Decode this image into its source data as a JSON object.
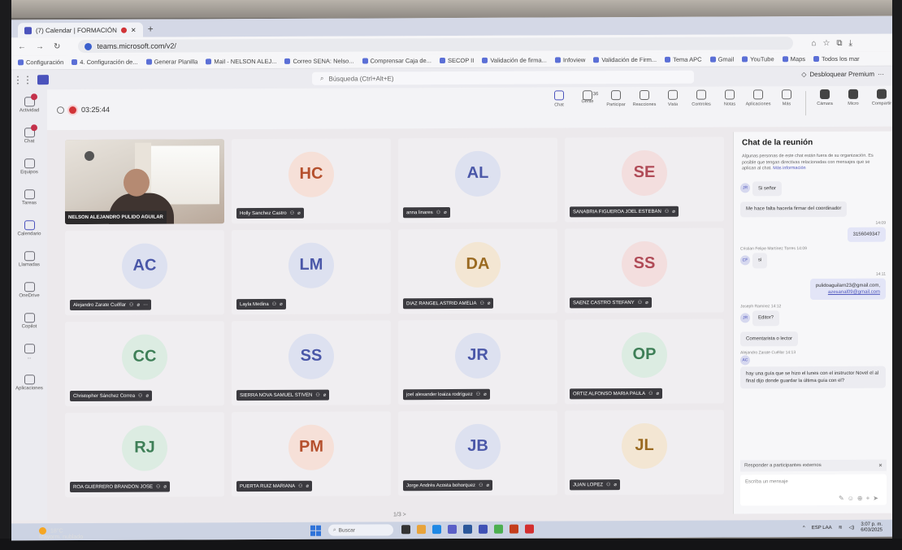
{
  "browser": {
    "tab_title": "(7) Calendar | FORMACIÓN",
    "url": "teams.microsoft.com/v2/",
    "bookmarks": [
      "Configuración",
      "4. Configuración de...",
      "Generar Planilla",
      "Mail - NELSON ALEJ...",
      "Correo SENA: Nelso...",
      "Comprensar Caja de...",
      "SECOP II",
      "Validación de firma...",
      "Infoview",
      "Validación de Firm...",
      "Tema APC",
      "Gmail",
      "YouTube",
      "Maps",
      "Todos los mar"
    ]
  },
  "teams": {
    "search_placeholder": "Búsqueda (Ctrl+Alt+E)",
    "premium_label": "Desbloquear Premium",
    "rail": [
      {
        "label": "Actividad",
        "badge": true
      },
      {
        "label": "Chat",
        "badge": true
      },
      {
        "label": "Equipos",
        "badge": false
      },
      {
        "label": "Tareas",
        "badge": false
      },
      {
        "label": "Calendario",
        "badge": false
      },
      {
        "label": "Llamadas",
        "badge": false
      },
      {
        "label": "OneDrive",
        "badge": false
      },
      {
        "label": "Copilot",
        "badge": false
      },
      {
        "label": "...",
        "badge": false
      },
      {
        "label": "Aplicaciones",
        "badge": false
      }
    ]
  },
  "meeting": {
    "elapsed": "03:25:44",
    "tools": [
      {
        "label": "Chat"
      },
      {
        "label": "Gente"
      },
      {
        "label": "Participar"
      },
      {
        "label": "Reacciones"
      },
      {
        "label": "Vista"
      },
      {
        "label": "Controles"
      },
      {
        "label": "Notas"
      },
      {
        "label": "Aplicaciones"
      },
      {
        "label": "Más"
      },
      {
        "label": "Cámara"
      },
      {
        "label": "Micro"
      },
      {
        "label": "Compartir"
      },
      {
        "label": "Salir"
      }
    ],
    "people_count": "36",
    "pager": "1/3 >"
  },
  "participants": [
    {
      "initials": "",
      "name": "NELSON ALEJANDRO PULIDO AGUILAR",
      "video": true
    },
    {
      "initials": "HC",
      "name": "Holly Sanchez Castro",
      "color": "orange"
    },
    {
      "initials": "AL",
      "name": "anna linares",
      "color": "blue"
    },
    {
      "initials": "SE",
      "name": "SANABRIA FIGUEROA JOEL ESTEBAN",
      "color": "pink"
    },
    {
      "initials": "AC",
      "name": "Alejandro Zarate Cuéllar",
      "color": "blue"
    },
    {
      "initials": "LM",
      "name": "Layla Medina",
      "color": "blue"
    },
    {
      "initials": "DA",
      "name": "DIAZ RANGEL ASTRID AMELIA",
      "color": "gold"
    },
    {
      "initials": "SS",
      "name": "SAENZ CASTRO STEFANY",
      "color": "pink"
    },
    {
      "initials": "CC",
      "name": "Christopher Sánchez Correa",
      "color": "green"
    },
    {
      "initials": "SS",
      "name": "SIERRA NOVA SAMUEL STIVEN",
      "color": "blue"
    },
    {
      "initials": "JR",
      "name": "joel alexander loaiza rodríguez",
      "color": "blue"
    },
    {
      "initials": "OP",
      "name": "ORTIZ ALFONSO MARIA PAULA",
      "color": "green"
    },
    {
      "initials": "RJ",
      "name": "ROA GUERRERO BRANDON JOSE",
      "color": "green"
    },
    {
      "initials": "PM",
      "name": "PUERTA RUIZ MARIANA",
      "color": "orange"
    },
    {
      "initials": "JB",
      "name": "Jorge Andrés Acosta bohorquez",
      "color": "blue"
    },
    {
      "initials": "JL",
      "name": "JUAN LOPEZ",
      "color": "gold"
    }
  ],
  "chat": {
    "title": "Chat de la reunión",
    "notice": "Algunas personas de este chat están fuera de su organización. Es posible que tengan directivas relacionadas con mensajes que se aplican al chat.",
    "notice_link": "Más información",
    "messages": [
      {
        "initials": "JR",
        "text": "Si señor"
      },
      {
        "text": "Me hace falta hacerla firmar del coordinador"
      },
      {
        "meta": "14:09",
        "text": "3156049347",
        "mine": true
      },
      {
        "meta": "Cristian Felipe Martínez Torres  14:09",
        "initials": "CF",
        "text": "si"
      },
      {
        "meta": "14:11",
        "text": "pulidoaguilarn23@gmail.com,",
        "link": "azesanal09@gmail.com",
        "mine": true
      },
      {
        "meta": "Joseph Ramírez  14:12",
        "initials": "JR",
        "text": "Editor?"
      },
      {
        "text": "Comentarista o lector"
      },
      {
        "meta": "Alejandro Zarate Cuéllar  14:13",
        "initials": "AC",
        "text": "hay una guía que se hizo el lunes con el instructor Novel el al final dijo donde guardar la última guía con el?"
      }
    ],
    "reply_banner": "Responder a participantes externos",
    "compose_placeholder": "Escriba un mensaje"
  },
  "taskbar": {
    "search_label": "Buscar",
    "lang": "ESP LAA",
    "time": "3:07 p. m.",
    "date": "6/03/2025"
  },
  "weather": {
    "temp": "18°C",
    "condition": "Mayorm. nublado"
  }
}
